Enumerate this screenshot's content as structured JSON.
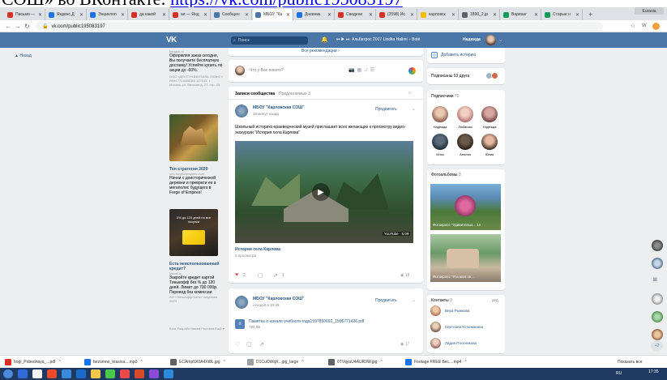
{
  "doc_strip": {
    "text": "СОШ» во ВКонтакте: ",
    "link": "https://vk.com/public195083197"
  },
  "tabs": [
    {
      "label": "Письмо —",
      "color": "#d93025"
    },
    {
      "label": "Яндекс.Д",
      "color": "#1a73e8"
    },
    {
      "label": "Энциклоп",
      "color": "#1a73e8"
    },
    {
      "label": "да какой",
      "color": "#d93025"
    },
    {
      "label": "ая — Янд",
      "color": "#d93025"
    },
    {
      "label": "Сообщен",
      "color": "#4a76a8"
    },
    {
      "label": "МБОУ \"Ка",
      "color": "#4a76a8",
      "active": true
    },
    {
      "label": "Дневник.",
      "color": "#1a73e8"
    },
    {
      "label": "Сведени",
      "color": "#d93025"
    },
    {
      "label": "(3598) Ис",
      "color": "#d93025"
    },
    {
      "label": "карловск",
      "color": "#fbbc04"
    },
    {
      "label": "1890_2.jp",
      "color": "#5f6368"
    },
    {
      "label": "Варианг",
      "color": "#0f9d58"
    },
    {
      "label": "Старые н",
      "color": "#0f9d58"
    }
  ],
  "window_controls": "Eurasia",
  "url": "vk.com/public195083197",
  "vk": {
    "search_placeholder": "Поиск",
    "player": "Альбатрос 2017 Lindita Halimi – Botë",
    "user": "Надежда"
  },
  "left_nav": "Назад",
  "ads": [
    {
      "domain": "kengoo.ru",
      "text": "Оформляя заказ сегодня, Вы получаете бесплатную доставку! Успейте купить по акции до -60%.",
      "small": "ООО «ДЕНТУН ВЕНТИЛЬ ОЗВИС» ИНН 7714408350 127015, г. Москва, ул. Вятская д. 27, стр. 15"
    },
    {
      "title": "Топ-стратегия 2020",
      "domain": "ooo.forgeofempires.com",
      "text": "Начни с доисторической деревни и преврати ее в мегаполис будущего в Forge of Empires!"
    },
    {
      "banner": "0% до 120 дней на все покупки",
      "title": "Есть неиспользованный кредит?",
      "domain": "tinkoff.ru",
      "text": "Закройте кредит картой Тинькофф без % до 120 дней. Лимит до 700 000р. Перевод без комиссии",
      "small": "АО «Тинькофф Банк» лицензия 2673"
    }
  ],
  "footer_links": "Блог Разработчикам Реклама Ещё ▾",
  "feed": {
    "recommend": "Все рекомендации ›",
    "whats_new": "Что у Вас нового?",
    "tabs": {
      "posts": "Записи сообщества",
      "suggested": "Предлагаемые 3"
    },
    "post1": {
      "author": "МБОУ \"Карловская СОШ\"",
      "time": "15 минут назад",
      "promote": "Продвигать",
      "text": "Школьный историко-краеведческий музей приглашает всех желающих к просмотру видео-экскурсии \"История села Карлова\"",
      "video_badge": "YouTube · 5:09",
      "video_title": "История села Карлова",
      "views_label": "2 просмотра",
      "likes": "2",
      "shares": "1",
      "views": "18"
    },
    "post2": {
      "author": "МБОУ \"Карловская СОШ\"",
      "time": "сегодня в 10:35",
      "promote": "Продвигать",
      "attachment": "Памятка о начале учебного года1597850692_1596771426.pdf",
      "size": "790 КБ",
      "views": "17"
    }
  },
  "right": {
    "add_story": "Добавить историю",
    "subscribed": "Подписаны 53 друга",
    "subscribers_title": "Подписчики",
    "subscribers_count": "70",
    "friends": [
      "Надежда",
      "Любашка",
      "Надежда",
      "Илья",
      "Анютка",
      "Юлия"
    ],
    "albums_title": "Фотоальбомы",
    "albums_count": "3",
    "album1": "Фотокросс \"Удивительн... 14",
    "album2": "Фотокросс \"Я и моя пе...",
    "contacts_title": "Контакты",
    "contacts_count": "3",
    "contacts_extra": "ред.",
    "contacts": [
      "Вера Рыжкова",
      "Светлана Устюжанина",
      "Лидия Плотникова"
    ]
  },
  "side_badge": "+2",
  "downloads": [
    {
      "name": "Itogi_Pobednaya_...pdf",
      "color": "#d93025"
    },
    {
      "name": "bezumno_krasiva....mp3",
      "color": "#1a73e8"
    },
    {
      "name": "ECAmp5X0A4Xt8L.jpg",
      "color": "#5f6368"
    },
    {
      "name": "D1CuOWqX...jpg_large",
      "color": "#9aa0a6"
    },
    {
      "name": "0TVqyuU4AUR3W.jpg",
      "color": "#5f6368"
    },
    {
      "name": "Footage FREE Бес....mp4",
      "color": "#1a73e8"
    }
  ],
  "show_all": "Показать все",
  "clock": {
    "lang": "RU",
    "time": "17:35"
  }
}
